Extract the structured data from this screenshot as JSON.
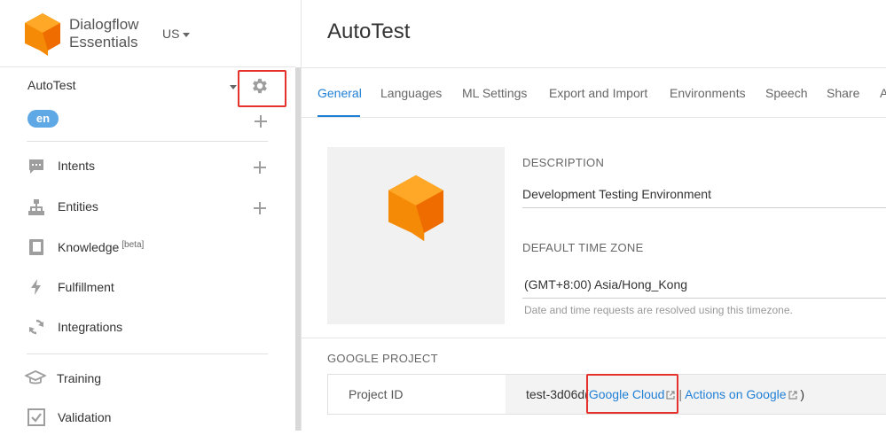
{
  "brand": {
    "line1": "Dialogflow",
    "line2": "Essentials",
    "region": "US"
  },
  "agent": {
    "name": "AutoTest",
    "language": "en"
  },
  "nav": {
    "intents": "Intents",
    "entities": "Entities",
    "knowledge": "Knowledge",
    "knowledge_badge": "[beta]",
    "fulfillment": "Fulfillment",
    "integrations": "Integrations",
    "training": "Training",
    "validation": "Validation"
  },
  "page": {
    "title": "AutoTest"
  },
  "tabs": [
    "General",
    "Languages",
    "ML Settings",
    "Export and Import",
    "Environments",
    "Speech",
    "Share",
    "A"
  ],
  "general": {
    "description_label": "DESCRIPTION",
    "description_value": "Development Testing Environment",
    "timezone_label": "DEFAULT TIME ZONE",
    "timezone_value": "(GMT+8:00) Asia/Hong_Kong",
    "timezone_hint": "Date and time requests are resolved using this timezone."
  },
  "google_project": {
    "section_label": "GOOGLE PROJECT",
    "project_id_label": "Project ID",
    "project_id_value": "test-3d06d",
    "open_paren": "(",
    "google_cloud_link": "Google Cloud",
    "separator": "|",
    "actions_link": "Actions on Google",
    "close_paren": ")"
  },
  "colors": {
    "accent": "#1f7fd6",
    "logo_orange": "#f58a07",
    "highlight": "#e5322d",
    "badge": "#5fa8e6"
  }
}
